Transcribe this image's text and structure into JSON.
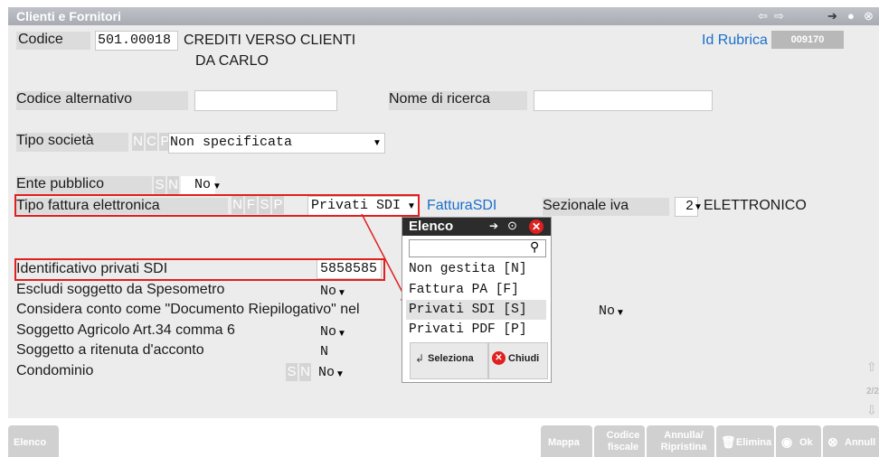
{
  "window": {
    "title": "Clienti e Fornitori"
  },
  "header": {
    "codice_label": "Codice",
    "codice_value": "501.00018",
    "name_line1": "CREDITI VERSO CLIENTI",
    "name_line2": "DA CARLO",
    "rubrica_label": "Id Rubrica",
    "rubrica_value": "009170"
  },
  "form": {
    "codice_alternativo_label": "Codice alternativo",
    "nome_ricerca_label": "Nome di ricerca",
    "tipo_societa_label": "Tipo società",
    "tipo_societa_letters": [
      "N",
      "C",
      "P"
    ],
    "tipo_societa_value": "Non specificata",
    "ente_pubblico_label": "Ente pubblico",
    "ente_pubblico_letters": [
      "S",
      "N"
    ],
    "ente_pubblico_value": "No",
    "tipo_fattura_label": "Tipo fattura elettronica",
    "tipo_fattura_letters": [
      "N",
      "F",
      "S",
      "P"
    ],
    "tipo_fattura_value": "Privati SDI",
    "fattura_sdi_link": "FatturaSDI",
    "sezionale_label": "Sezionale iva",
    "sezionale_value": "2",
    "sezionale_desc": "ELETTRONICO",
    "identificativo_label": "Identificativo privati SDI",
    "identificativo_value": "5858585",
    "escludi_label": "Escludi soggetto da Spesometro",
    "escludi_value": "No",
    "considera_label": "Considera conto come \"Documento Riepilogativo\" nel",
    "considera_value": "No",
    "agricolo_label": "Soggetto Agricolo Art.34 comma 6",
    "agricolo_value": "No",
    "ritenuta_label": "Soggetto a ritenuta d'acconto",
    "ritenuta_value": "N",
    "condominio_label": "Condominio",
    "condominio_letters": [
      "S",
      "N"
    ],
    "condominio_value": "No"
  },
  "popup": {
    "title": "Elenco",
    "items": [
      "Non gestita [N]",
      "Fattura PA  [F]",
      "Privati SDI [S]",
      "Privati PDF [P]"
    ],
    "selected_index": 2,
    "select_label": "Seleziona",
    "close_label": "Chiudi"
  },
  "side": {
    "page": "2/2"
  },
  "footer": {
    "elenco": "Elenco",
    "mappa": "Mappa",
    "codice_fiscale": "Codice fiscale",
    "annulla_ripristina": "Annulla/ Ripristina",
    "elimina": "Elimina",
    "ok": "Ok",
    "annulla": "Annull"
  }
}
